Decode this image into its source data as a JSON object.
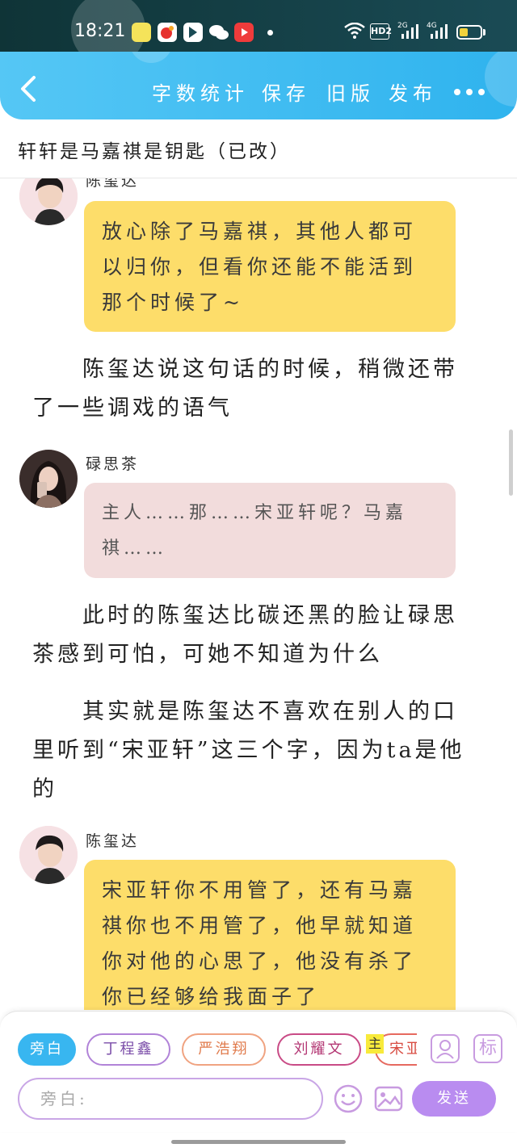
{
  "status_bar": {
    "time": "18:21",
    "hd": "HD2",
    "sim1": "2G",
    "sim2": "4G",
    "battery_level": 0.4,
    "battery_color": "#f2d23b"
  },
  "header": {
    "actions": [
      "字数统计",
      "保存",
      "旧版",
      "发布"
    ],
    "back_icon": "chevron-left-icon",
    "more_icon": "more-dots-icon",
    "colors": {
      "start": "#55c7f5",
      "end": "#2fb3ee"
    }
  },
  "title": "轩轩是马嘉祺是钥匙（已改）",
  "content": {
    "blocks": [
      {
        "type": "dialogue",
        "speaker": "陈玺达",
        "text": "放心除了马嘉祺，其他人都可以归你，但看你还能不能活到那个时候了~",
        "bubble_color": "#fddd6a"
      },
      {
        "type": "narration",
        "text": "陈玺达说这句话的时候，稍微还带了一些调戏的语气"
      },
      {
        "type": "dialogue",
        "speaker": "碌思茶",
        "text": "主人……那……宋亚轩呢？马嘉祺……",
        "bubble_color": "#f2dcdc"
      },
      {
        "type": "narration",
        "text": "此时的陈玺达比碳还黑的脸让碌思茶感到可怕，可她不知道为什么"
      },
      {
        "type": "narration",
        "text": "其实就是陈玺达不喜欢在别人的口里听到“宋亚轩”这三个字，因为ta是他的"
      },
      {
        "type": "dialogue",
        "speaker": "陈玺达",
        "text": "宋亚轩你不用管了，还有马嘉祺你也不用管了，他早就知道你对他的心思了，他没有杀了你已经够给我面子了",
        "bubble_color": "#fddd6a"
      }
    ]
  },
  "bottom_panel": {
    "roles": [
      "旁白",
      "丁程鑫",
      "严浩翔",
      "刘耀文",
      "宋亚"
    ],
    "active_role": "旁白",
    "main_tag": "主",
    "icons": [
      "person-card-icon",
      "label-icon",
      "emoji-icon",
      "image-icon"
    ],
    "label_icon_text": "标",
    "input_placeholder": "旁白:",
    "send_label": "发送"
  }
}
